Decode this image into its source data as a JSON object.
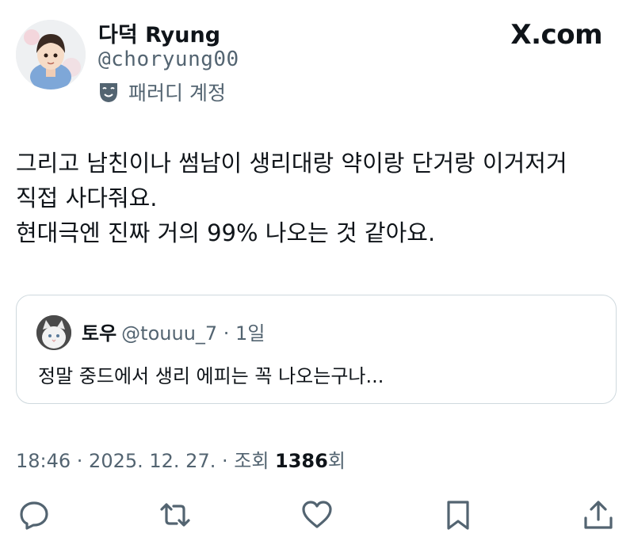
{
  "author": {
    "display_name": "다덕 Ryung",
    "handle": "@choryung00",
    "parody_label": "패러디 계정",
    "avatar_icon": "avatar-illustration"
  },
  "brand": {
    "label": "X.com"
  },
  "tweet": {
    "lines": [
      "그리고 남친이나 썸남이 생리대랑 약이랑 단거랑 이거저거",
      "직접 사다줘요.",
      "현대극엔 진짜 거의 99% 나오는 것 같아요."
    ]
  },
  "quote": {
    "name": "토우",
    "handle_time": "@touuu_7 · 1일",
    "text": "정말 중드에서 생리 에피는 꼭 나오는구나..."
  },
  "meta": {
    "timestamp": "18:46 · 2025. 12. 27. · 조회 ",
    "view_count": "1386",
    "view_suffix": "회"
  },
  "actions": [
    "reply-icon",
    "retweet-icon",
    "like-icon",
    "bookmark-icon",
    "share-icon"
  ],
  "colors": {
    "text": "#0f1419",
    "secondary": "#536471",
    "border": "#cfd9de",
    "icon": "#536471"
  }
}
